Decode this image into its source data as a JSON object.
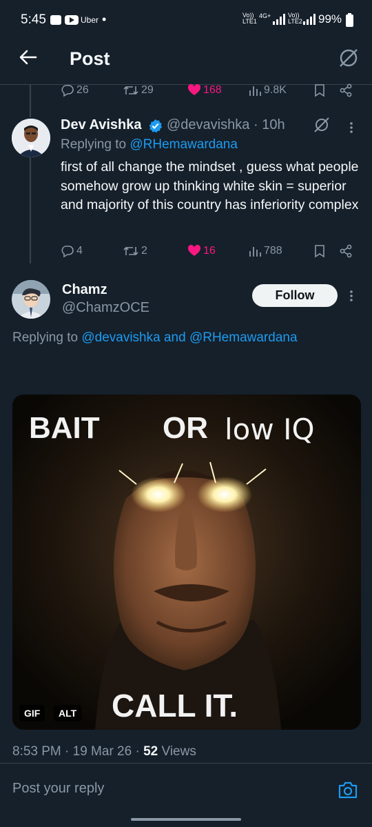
{
  "status_bar": {
    "time": "5:45",
    "app_label": "Uber",
    "network_1": "Vo)) LTE1",
    "network_type": "4G+",
    "network_2": "Vo)) LTE2",
    "battery": "99%"
  },
  "header": {
    "title": "Post"
  },
  "prev_post_actions": {
    "replies": "26",
    "reposts": "29",
    "likes": "168",
    "views": "9.8K"
  },
  "reply_post": {
    "name": "Dev Avishka",
    "handle": "@devavishka",
    "time": "· 10h",
    "replying_prefix": "Replying to",
    "replying_to": "@RHemawardana",
    "text": "first of all change the mindset , guess what people somehow grow up thinking white skin = superior and majority of this country has inferiority complex",
    "replies": "4",
    "reposts": "2",
    "likes": "16",
    "views": "788"
  },
  "main_post": {
    "name": "Chamz",
    "handle": "@ChamzOCE",
    "follow_label": "Follow",
    "replying_prefix": "Replying to",
    "replying_to": "@devavishka and @RHemawardana",
    "media": {
      "top_text_1": "BAIT",
      "top_text_2": "OR",
      "top_text_3": "low IQ",
      "bottom_text": "CALL IT.",
      "gif_badge": "GIF",
      "alt_badge": "ALT"
    },
    "timestamp": "8:53 PM · 19 Mar 26 ·",
    "views_count": "52",
    "views_label": "Views"
  },
  "reply_bar": {
    "placeholder": "Post your reply"
  },
  "colors": {
    "background": "#15202b",
    "accent": "#1d9bf0",
    "like": "#f91880",
    "muted": "#8b98a5"
  }
}
